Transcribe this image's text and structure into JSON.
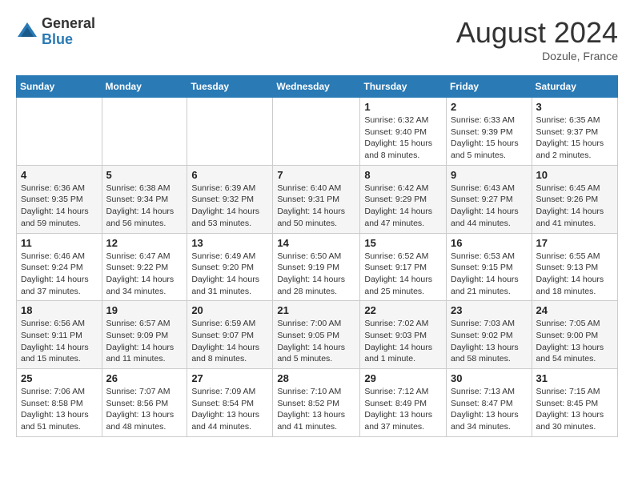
{
  "header": {
    "logo_general": "General",
    "logo_blue": "Blue",
    "month_title": "August 2024",
    "location": "Dozule, France"
  },
  "days_of_week": [
    "Sunday",
    "Monday",
    "Tuesday",
    "Wednesday",
    "Thursday",
    "Friday",
    "Saturday"
  ],
  "weeks": [
    [
      {
        "day": "",
        "info": ""
      },
      {
        "day": "",
        "info": ""
      },
      {
        "day": "",
        "info": ""
      },
      {
        "day": "",
        "info": ""
      },
      {
        "day": "1",
        "info": "Sunrise: 6:32 AM\nSunset: 9:40 PM\nDaylight: 15 hours and 8 minutes."
      },
      {
        "day": "2",
        "info": "Sunrise: 6:33 AM\nSunset: 9:39 PM\nDaylight: 15 hours and 5 minutes."
      },
      {
        "day": "3",
        "info": "Sunrise: 6:35 AM\nSunset: 9:37 PM\nDaylight: 15 hours and 2 minutes."
      }
    ],
    [
      {
        "day": "4",
        "info": "Sunrise: 6:36 AM\nSunset: 9:35 PM\nDaylight: 14 hours and 59 minutes."
      },
      {
        "day": "5",
        "info": "Sunrise: 6:38 AM\nSunset: 9:34 PM\nDaylight: 14 hours and 56 minutes."
      },
      {
        "day": "6",
        "info": "Sunrise: 6:39 AM\nSunset: 9:32 PM\nDaylight: 14 hours and 53 minutes."
      },
      {
        "day": "7",
        "info": "Sunrise: 6:40 AM\nSunset: 9:31 PM\nDaylight: 14 hours and 50 minutes."
      },
      {
        "day": "8",
        "info": "Sunrise: 6:42 AM\nSunset: 9:29 PM\nDaylight: 14 hours and 47 minutes."
      },
      {
        "day": "9",
        "info": "Sunrise: 6:43 AM\nSunset: 9:27 PM\nDaylight: 14 hours and 44 minutes."
      },
      {
        "day": "10",
        "info": "Sunrise: 6:45 AM\nSunset: 9:26 PM\nDaylight: 14 hours and 41 minutes."
      }
    ],
    [
      {
        "day": "11",
        "info": "Sunrise: 6:46 AM\nSunset: 9:24 PM\nDaylight: 14 hours and 37 minutes."
      },
      {
        "day": "12",
        "info": "Sunrise: 6:47 AM\nSunset: 9:22 PM\nDaylight: 14 hours and 34 minutes."
      },
      {
        "day": "13",
        "info": "Sunrise: 6:49 AM\nSunset: 9:20 PM\nDaylight: 14 hours and 31 minutes."
      },
      {
        "day": "14",
        "info": "Sunrise: 6:50 AM\nSunset: 9:19 PM\nDaylight: 14 hours and 28 minutes."
      },
      {
        "day": "15",
        "info": "Sunrise: 6:52 AM\nSunset: 9:17 PM\nDaylight: 14 hours and 25 minutes."
      },
      {
        "day": "16",
        "info": "Sunrise: 6:53 AM\nSunset: 9:15 PM\nDaylight: 14 hours and 21 minutes."
      },
      {
        "day": "17",
        "info": "Sunrise: 6:55 AM\nSunset: 9:13 PM\nDaylight: 14 hours and 18 minutes."
      }
    ],
    [
      {
        "day": "18",
        "info": "Sunrise: 6:56 AM\nSunset: 9:11 PM\nDaylight: 14 hours and 15 minutes."
      },
      {
        "day": "19",
        "info": "Sunrise: 6:57 AM\nSunset: 9:09 PM\nDaylight: 14 hours and 11 minutes."
      },
      {
        "day": "20",
        "info": "Sunrise: 6:59 AM\nSunset: 9:07 PM\nDaylight: 14 hours and 8 minutes."
      },
      {
        "day": "21",
        "info": "Sunrise: 7:00 AM\nSunset: 9:05 PM\nDaylight: 14 hours and 5 minutes."
      },
      {
        "day": "22",
        "info": "Sunrise: 7:02 AM\nSunset: 9:03 PM\nDaylight: 14 hours and 1 minute."
      },
      {
        "day": "23",
        "info": "Sunrise: 7:03 AM\nSunset: 9:02 PM\nDaylight: 13 hours and 58 minutes."
      },
      {
        "day": "24",
        "info": "Sunrise: 7:05 AM\nSunset: 9:00 PM\nDaylight: 13 hours and 54 minutes."
      }
    ],
    [
      {
        "day": "25",
        "info": "Sunrise: 7:06 AM\nSunset: 8:58 PM\nDaylight: 13 hours and 51 minutes."
      },
      {
        "day": "26",
        "info": "Sunrise: 7:07 AM\nSunset: 8:56 PM\nDaylight: 13 hours and 48 minutes."
      },
      {
        "day": "27",
        "info": "Sunrise: 7:09 AM\nSunset: 8:54 PM\nDaylight: 13 hours and 44 minutes."
      },
      {
        "day": "28",
        "info": "Sunrise: 7:10 AM\nSunset: 8:52 PM\nDaylight: 13 hours and 41 minutes."
      },
      {
        "day": "29",
        "info": "Sunrise: 7:12 AM\nSunset: 8:49 PM\nDaylight: 13 hours and 37 minutes."
      },
      {
        "day": "30",
        "info": "Sunrise: 7:13 AM\nSunset: 8:47 PM\nDaylight: 13 hours and 34 minutes."
      },
      {
        "day": "31",
        "info": "Sunrise: 7:15 AM\nSunset: 8:45 PM\nDaylight: 13 hours and 30 minutes."
      }
    ]
  ]
}
